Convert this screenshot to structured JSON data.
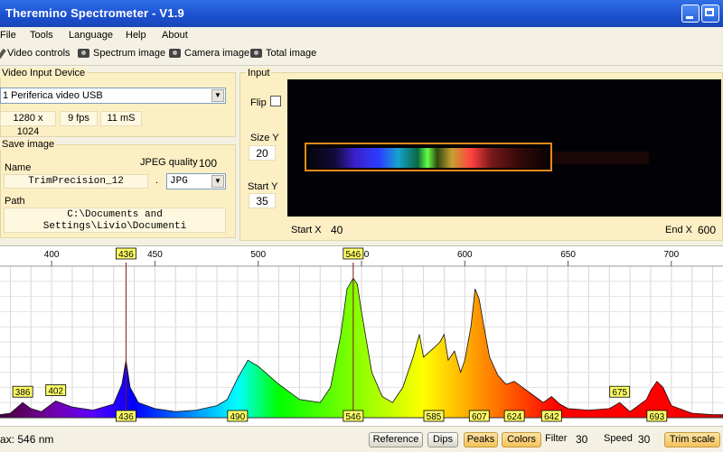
{
  "window": {
    "title": "Theremino Spectrometer - V1.9"
  },
  "menu": [
    "File",
    "Tools",
    "Language",
    "Help",
    "About"
  ],
  "toolbar": {
    "video_controls": "Video controls",
    "spectrum_image": "Spectrum image",
    "camera_image": "Camera image",
    "total_image": "Total image"
  },
  "video_input": {
    "group_label": "Video Input Device",
    "device": "1 Periferica video USB",
    "resolution": "1280 x 1024",
    "fps": "9 fps",
    "exposure": "11 mS"
  },
  "save_image": {
    "group_label": "Save image",
    "name_label": "Name",
    "name_value": "TrimPrecision_12",
    "dot": ".",
    "jpeg_quality_label": "JPEG quality",
    "jpeg_quality_value": "100",
    "format": "JPG",
    "path_label": "Path",
    "path_line1": "C:\\Documents and",
    "path_line2": "Settings\\Livio\\Documenti"
  },
  "input": {
    "group_label": "Input",
    "flip_label": "Flip",
    "size_y_label": "Size Y",
    "size_y_value": "20",
    "start_y_label": "Start Y",
    "start_y_value": "35",
    "start_x_label": "Start X",
    "start_x_value": "40",
    "end_x_label": "End X",
    "end_x_value": "600"
  },
  "status": {
    "max_label": "ax: 546 nm",
    "buttons": {
      "reference": "Reference",
      "dips": "Dips",
      "peaks": "Peaks",
      "colors": "Colors"
    },
    "filter_label": "Filter",
    "filter_value": "30",
    "speed_label": "Speed",
    "speed_value": "30",
    "trim_scale": "Trim scale"
  },
  "colors": {
    "peak_label_bg": "#ffff66",
    "selected_button": "#f4c25c"
  },
  "chart_data": {
    "type": "area",
    "xlabel": "",
    "ylabel": "",
    "x_ticks": [
      400,
      450,
      500,
      550,
      600,
      650,
      700
    ],
    "xlim": [
      375,
      725
    ],
    "ylim": [
      0,
      100
    ],
    "grid": true,
    "trim_markers": [
      436,
      546
    ],
    "x": [
      375,
      380,
      386,
      390,
      395,
      402,
      410,
      420,
      430,
      434,
      436,
      438,
      442,
      450,
      460,
      470,
      480,
      485,
      490,
      495,
      500,
      510,
      520,
      530,
      535,
      540,
      543,
      546,
      548,
      550,
      555,
      560,
      565,
      570,
      575,
      578,
      580,
      585,
      588,
      590,
      592,
      595,
      598,
      600,
      603,
      605,
      607,
      609,
      612,
      616,
      620,
      624,
      628,
      634,
      638,
      642,
      646,
      650,
      660,
      670,
      675,
      680,
      684,
      688,
      690,
      693,
      696,
      700,
      710,
      720,
      725
    ],
    "values": [
      2,
      3,
      10,
      6,
      4,
      11,
      7,
      5,
      9,
      22,
      38,
      20,
      10,
      6,
      4,
      5,
      8,
      12,
      26,
      38,
      34,
      22,
      12,
      10,
      20,
      55,
      85,
      92,
      88,
      70,
      30,
      14,
      10,
      20,
      40,
      55,
      40,
      46,
      50,
      55,
      38,
      44,
      30,
      38,
      60,
      85,
      78,
      62,
      40,
      28,
      22,
      24,
      20,
      14,
      10,
      14,
      9,
      6,
      5,
      6,
      10,
      4,
      8,
      12,
      18,
      24,
      20,
      8,
      3,
      2,
      2
    ],
    "peak_labels": [
      {
        "x": 386,
        "label": "386",
        "position": "upper"
      },
      {
        "x": 402,
        "label": "402",
        "position": "upper"
      },
      {
        "x": 436,
        "label": "436",
        "position": "top"
      },
      {
        "x": 546,
        "label": "546",
        "position": "top"
      },
      {
        "x": 675,
        "label": "675",
        "position": "upper"
      },
      {
        "x": 436,
        "label": "436",
        "position": "bottom"
      },
      {
        "x": 490,
        "label": "490",
        "position": "bottom"
      },
      {
        "x": 546,
        "label": "546",
        "position": "bottom"
      },
      {
        "x": 585,
        "label": "585",
        "position": "bottom"
      },
      {
        "x": 607,
        "label": "607",
        "position": "bottom"
      },
      {
        "x": 624,
        "label": "624",
        "position": "bottom"
      },
      {
        "x": 642,
        "label": "642",
        "position": "bottom"
      },
      {
        "x": 693,
        "label": "693",
        "position": "bottom"
      }
    ]
  }
}
